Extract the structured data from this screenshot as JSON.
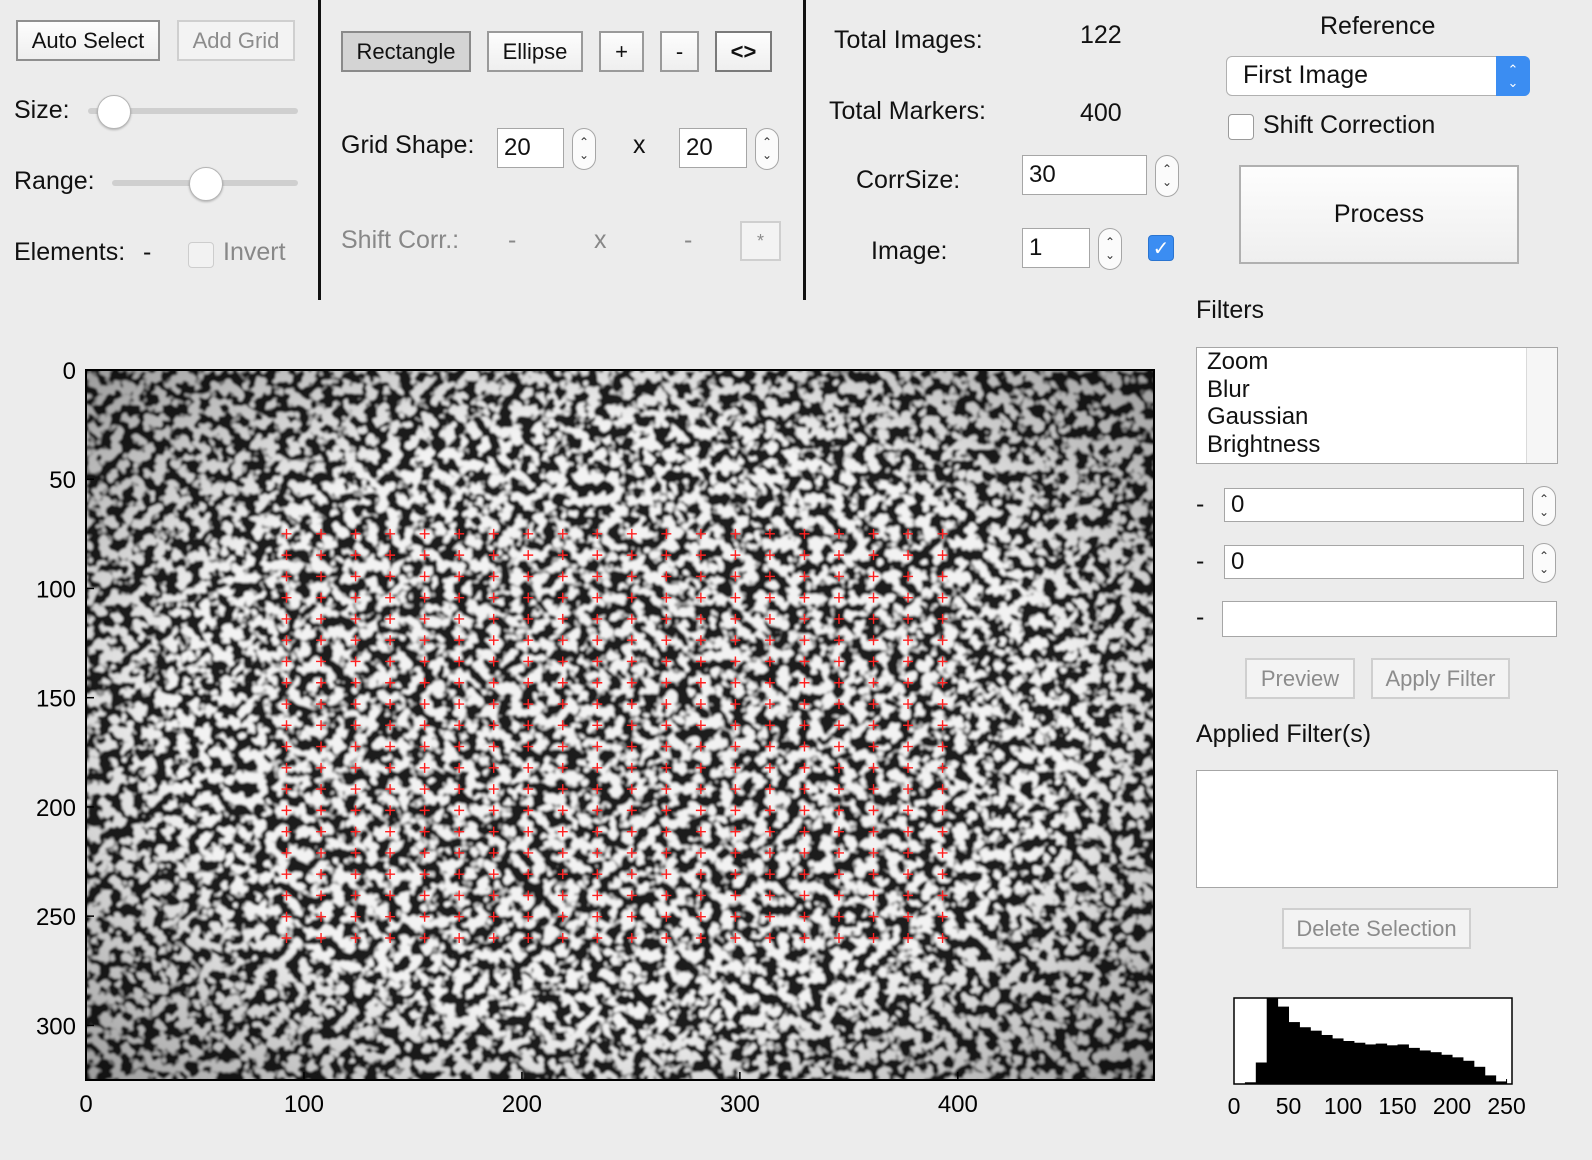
{
  "left_panel": {
    "auto_select_label": "Auto Select",
    "add_grid_label": "Add Grid",
    "size_label": "Size:",
    "size_value": 0.12,
    "range_label": "Range:",
    "range_value": 0.5,
    "elements_label": "Elements:",
    "elements_value": "-",
    "invert_label": "Invert"
  },
  "middle_panel": {
    "rectangle_label": "Rectangle",
    "ellipse_label": "Ellipse",
    "plus_label": "+",
    "minus_label": "-",
    "swap_label": "<>",
    "grid_shape_label": "Grid Shape:",
    "grid_rows": "20",
    "grid_x": "x",
    "grid_cols": "20",
    "shift_corr_label": "Shift Corr.:",
    "shift_x_value": "-",
    "shift_x_sep": "x",
    "shift_y_value": "-",
    "star_label": "*"
  },
  "stats_panel": {
    "total_images_label": "Total Images:",
    "total_images_value": "122",
    "total_markers_label": "Total Markers:",
    "total_markers_value": "400",
    "corrsize_label": "CorrSize:",
    "corrsize_value": "30",
    "image_label": "Image:",
    "image_value": "1"
  },
  "reference_panel": {
    "title": "Reference",
    "select_value": "First Image",
    "shift_correction_label": "Shift Correction",
    "process_label": "Process"
  },
  "filters_panel": {
    "title": "Filters",
    "items": [
      "Zoom",
      "Blur",
      "Gaussian",
      "Brightness"
    ],
    "param_dash": "-",
    "param1_value": "0",
    "param2_value": "0",
    "param3_value": "",
    "preview_label": "Preview",
    "apply_label": "Apply Filter",
    "applied_title": "Applied Filter(s)",
    "delete_label": "Delete Selection"
  },
  "image_plot": {
    "x_ticks": [
      "0",
      "100",
      "200",
      "300",
      "400"
    ],
    "y_ticks": [
      "0",
      "50",
      "100",
      "150",
      "200",
      "250",
      "300"
    ],
    "x_range": [
      0,
      490
    ],
    "y_range": [
      0,
      325
    ],
    "grid_x_start": 92,
    "grid_x_end": 393,
    "grid_y_start": 75,
    "grid_y_end": 260,
    "grid_rows": 20,
    "grid_cols": 20,
    "marker_color": "#ff2020"
  },
  "chart_data": {
    "type": "bar",
    "x_ticks": [
      "0",
      "50",
      "100",
      "150",
      "200",
      "250"
    ],
    "xlim": [
      0,
      255
    ],
    "bin_starts": [
      0,
      10,
      20,
      30,
      40,
      50,
      60,
      70,
      80,
      90,
      100,
      110,
      120,
      130,
      140,
      150,
      160,
      170,
      180,
      190,
      200,
      210,
      220,
      230,
      240
    ],
    "values": [
      0.0,
      0.02,
      0.25,
      1.0,
      0.9,
      0.72,
      0.66,
      0.62,
      0.57,
      0.53,
      0.5,
      0.48,
      0.46,
      0.47,
      0.45,
      0.46,
      0.42,
      0.39,
      0.37,
      0.34,
      0.31,
      0.27,
      0.2,
      0.1,
      0.03
    ],
    "ylim": [
      0,
      1
    ]
  }
}
